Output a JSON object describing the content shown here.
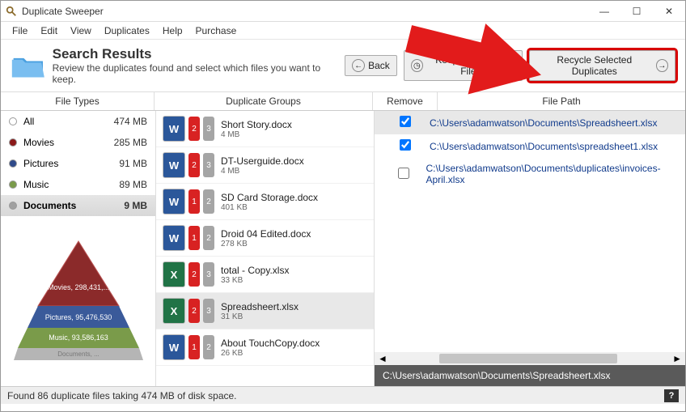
{
  "window": {
    "title": "Duplicate Sweeper"
  },
  "menu": {
    "items": [
      "File",
      "Edit",
      "View",
      "Duplicates",
      "Help",
      "Purchase"
    ]
  },
  "header": {
    "title": "Search Results",
    "subtitle": "Review the duplicates found and select which files you want to keep.",
    "back": "Back",
    "keep": "Keep All Newest Files",
    "recycle": "Recycle Selected Duplicates"
  },
  "columns": {
    "c1": "File Types",
    "c2": "Duplicate Groups",
    "c3": "Remove",
    "c4": "File Path"
  },
  "filetypes": [
    {
      "name": "All",
      "size": "474 MB",
      "color": "#ffffff"
    },
    {
      "name": "Movies",
      "size": "285 MB",
      "color": "#8b1a1a"
    },
    {
      "name": "Pictures",
      "size": "91 MB",
      "color": "#2f4a8a"
    },
    {
      "name": "Music",
      "size": "89 MB",
      "color": "#7a9b4a"
    },
    {
      "name": "Documents",
      "size": "9 MB",
      "color": "#a0a0a0"
    }
  ],
  "selected_filetype": 4,
  "pyramid": {
    "layers": [
      {
        "label": "Movies, 298,431,...",
        "color": "#8b2a2a"
      },
      {
        "label": "Pictures, 95,476,530",
        "color": "#3a5a9a"
      },
      {
        "label": "Music, 93,586,163",
        "color": "#7a9b4a"
      },
      {
        "label": "Documents, ...",
        "color": "#a5a5a5"
      }
    ]
  },
  "groups": [
    {
      "name": "Short Story.docx",
      "size": "4 MB",
      "type": "word",
      "chips": [
        "2",
        "3"
      ]
    },
    {
      "name": "DT-Userguide.docx",
      "size": "4 MB",
      "type": "word",
      "chips": [
        "2",
        "3"
      ]
    },
    {
      "name": "SD Card Storage.docx",
      "size": "401 KB",
      "type": "word",
      "chips": [
        "1",
        "2"
      ]
    },
    {
      "name": "Droid 04 Edited.docx",
      "size": "278 KB",
      "type": "word",
      "chips": [
        "1",
        "2"
      ]
    },
    {
      "name": "total - Copy.xlsx",
      "size": "33 KB",
      "type": "excel",
      "chips": [
        "2",
        "3"
      ]
    },
    {
      "name": "Spreadsheert.xlsx",
      "size": "31 KB",
      "type": "excel",
      "chips": [
        "2",
        "3"
      ]
    },
    {
      "name": "About TouchCopy.docx",
      "size": "26 KB",
      "type": "word",
      "chips": [
        "1",
        "2"
      ]
    }
  ],
  "selected_group": 5,
  "files": [
    {
      "checked": true,
      "path": "C:\\Users\\adamwatson\\Documents\\Spreadsheert.xlsx"
    },
    {
      "checked": true,
      "path": "C:\\Users\\adamwatson\\Documents\\spreadsheet1.xlsx"
    },
    {
      "checked": false,
      "path": "C:\\Users\\adamwatson\\Documents\\duplicates\\invoices-April.xlsx"
    }
  ],
  "selected_file": 0,
  "selected_path": "C:\\Users\\adamwatson\\Documents\\Spreadsheert.xlsx",
  "status": "Found 86 duplicate files taking 474 MB of disk space."
}
